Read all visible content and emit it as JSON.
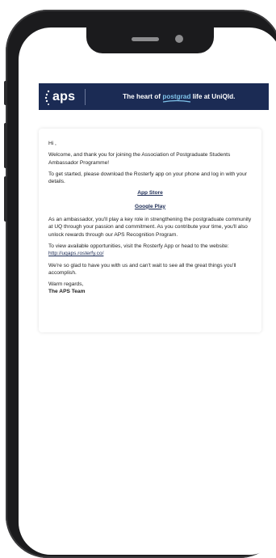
{
  "banner": {
    "logo_text": "aps",
    "tag_before": "The heart of ",
    "tag_accent": "postgrad",
    "tag_after": " life at UniQld."
  },
  "email": {
    "greeting": "Hi ,",
    "welcome": "Welcome, and thank you for joining the Association of Postgraduate Students Ambassador Programme!",
    "instructions": "To get started, please download the Rosterfy app on your phone and log in with your details.",
    "app_store_label": "App Store",
    "google_play_label": "Google Play",
    "role": "As an ambassador, you'll play a key role in strengthening the postgraduate community at UQ through your passion and commitment. As you contribute your time, you'll also unlock rewards through our APS Recognition Program.",
    "opportunities": "To view available opportunities, visit the Rosterfy App or head to the website: ",
    "website_link": "http://uqaps.rosterfy.co/",
    "closing_note": "We're so glad to have you with us and can't wait to see all the great things you'll accomplish.",
    "sign_off": "Warm regards,",
    "signature": "The APS Team"
  },
  "colors": {
    "banner_bg": "#1b2b54",
    "accent": "#7fc3ea",
    "link": "#1b2b54",
    "phone_frame": "#1b1b1d"
  }
}
